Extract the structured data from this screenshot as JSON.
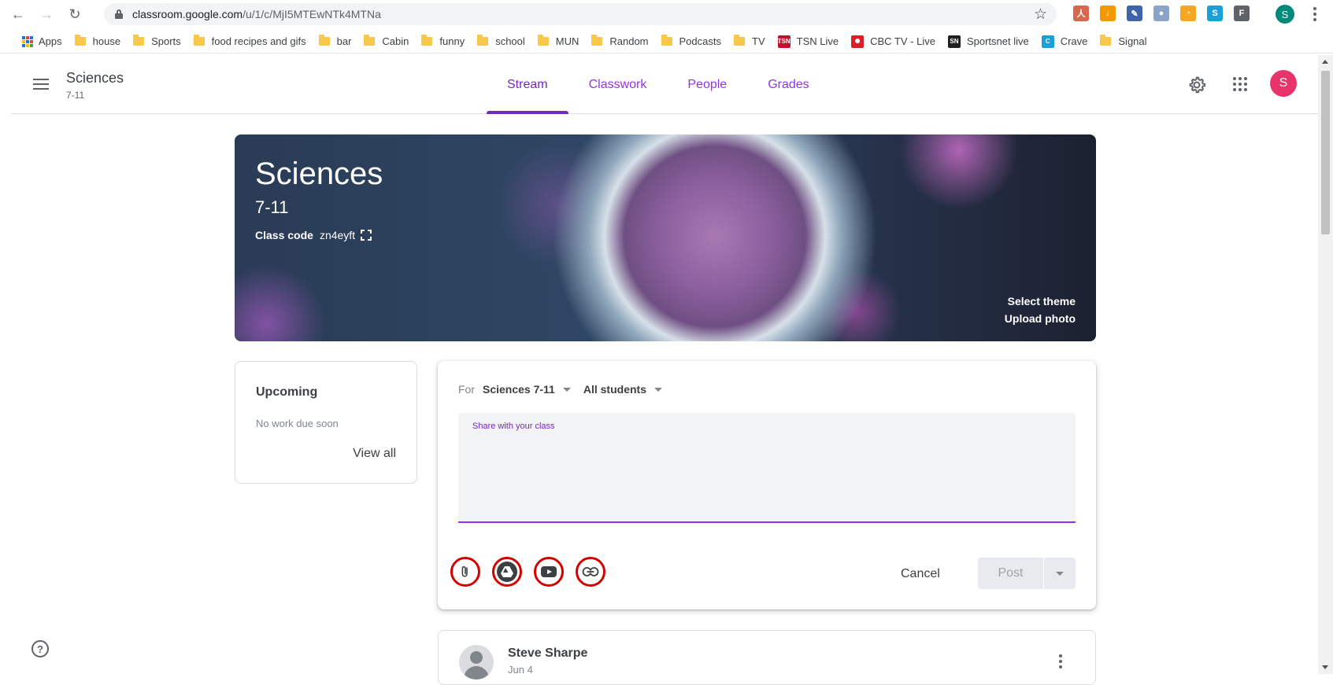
{
  "browser": {
    "url_host": "classroom.google.com",
    "url_path": "/u/1/c/MjI5MTEwNTk4MTNa",
    "profile_initial": "S",
    "extensions": [
      {
        "icon": "pdf-extension-icon",
        "color": "#d9664f",
        "glyph": "人"
      },
      {
        "icon": "download-extension-icon",
        "color": "#f29900",
        "glyph": "↓"
      },
      {
        "icon": "pen-extension-icon",
        "color": "#3f63a8",
        "glyph": "✎"
      },
      {
        "icon": "circle-extension-icon",
        "color": "#8aa4c8",
        "glyph": "●"
      },
      {
        "icon": "ring-extension-icon",
        "color": "#f5a623",
        "glyph": "◔"
      },
      {
        "icon": "s-extension-icon",
        "color": "#1a9fd9",
        "glyph": "S"
      },
      {
        "icon": "f-extension-icon",
        "color": "#5f6368",
        "glyph": "F"
      }
    ]
  },
  "bookmarks": [
    {
      "label": "Apps",
      "icon": "apps-icon"
    },
    {
      "label": "house",
      "icon": "folder-icon"
    },
    {
      "label": "Sports",
      "icon": "folder-icon"
    },
    {
      "label": "food recipes and gifs",
      "icon": "folder-icon"
    },
    {
      "label": "bar",
      "icon": "folder-icon"
    },
    {
      "label": "Cabin",
      "icon": "folder-icon"
    },
    {
      "label": "funny",
      "icon": "folder-icon"
    },
    {
      "label": "school",
      "icon": "folder-icon"
    },
    {
      "label": "MUN",
      "icon": "folder-icon"
    },
    {
      "label": "Random",
      "icon": "folder-icon"
    },
    {
      "label": "Podcasts",
      "icon": "folder-icon"
    },
    {
      "label": "TV",
      "icon": "folder-icon"
    },
    {
      "label": "TSN Live",
      "icon": "tsn-icon",
      "color": "#c8102e",
      "glyph": "TSN"
    },
    {
      "label": "CBC TV - Live",
      "icon": "cbc-icon",
      "color": "#d61f26",
      "glyph": "✺"
    },
    {
      "label": "Sportsnet live",
      "icon": "sportsnet-icon",
      "color": "#1f1f1f",
      "glyph": "SN"
    },
    {
      "label": "Crave",
      "icon": "crave-icon",
      "color": "#1a9fd9",
      "glyph": "C"
    },
    {
      "label": "Signal",
      "icon": "folder-icon"
    }
  ],
  "header": {
    "class_name": "Sciences",
    "section": "7-11",
    "tabs": [
      {
        "label": "Stream",
        "active": true
      },
      {
        "label": "Classwork",
        "active": false
      },
      {
        "label": "People",
        "active": false
      },
      {
        "label": "Grades",
        "active": false
      }
    ],
    "user_initial": "S"
  },
  "banner": {
    "title": "Sciences",
    "section": "7-11",
    "class_code_label": "Class code",
    "class_code": "zn4eyft",
    "select_theme": "Select theme",
    "upload_photo": "Upload photo"
  },
  "upcoming": {
    "title": "Upcoming",
    "empty_text": "No work due soon",
    "view_all": "View all"
  },
  "composer": {
    "for_label": "For",
    "class_select": "Sciences 7-11",
    "audience_select": "All students",
    "share_placeholder": "Share with your class",
    "cancel": "Cancel",
    "post": "Post"
  },
  "post": {
    "author": "Steve Sharpe",
    "date": "Jun 4"
  },
  "colors": {
    "accent": "#7627bb",
    "tab_color": "#9334e6",
    "avatar": "#e8336b",
    "highlight_ring": "#d50000"
  }
}
